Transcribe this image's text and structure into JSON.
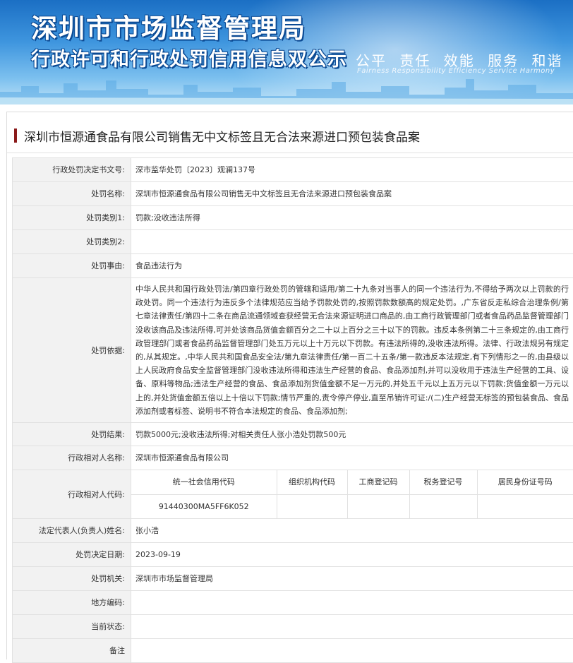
{
  "banner": {
    "title": "深圳市市场监督管理局",
    "subtitle": "行政许可和行政处罚信用信息双公示",
    "slogan": [
      "公平",
      "责任",
      "效能",
      "服务",
      "和谐"
    ],
    "slogan_en": "Fairness  Responsibility  Efficiency  Service  Harmony"
  },
  "case_title": "深圳市恒源通食品有限公司销售无中文标签且无合法来源进口预包装食品案",
  "rows": {
    "decision_no": {
      "label": "行政处罚决定书文号:",
      "value": "深市监华处罚〔2023〕观澜137号"
    },
    "name": {
      "label": "处罚名称:",
      "value": "深圳市恒源通食品有限公司销售无中文标签且无合法来源进口预包装食品案"
    },
    "category1": {
      "label": "处罚类别1:",
      "value": "罚款;没收违法所得"
    },
    "category2": {
      "label": "处罚类别2:",
      "value": ""
    },
    "reason": {
      "label": "处罚事由:",
      "value": "食品违法行为"
    },
    "basis": {
      "label": "处罚依据:",
      "value": "中华人民共和国行政处罚法/第四章行政处罚的管辖和适用/第二十九条对当事人的同一个违法行为,不得给予两次以上罚款的行政处罚。同一个违法行为违反多个法律规范应当给予罚款处罚的,按照罚款数额高的规定处罚。,广东省反走私综合治理条例/第七章法律责任/第四十二条在商品流通领域查获经营无合法来源证明进口商品的,由工商行政管理部门或者食品药品监督管理部门没收该商品及违法所得,可并处该商品货值金额百分之二十以上百分之三十以下的罚款。违反本条例第二十三条规定的,由工商行政管理部门或者食品药品监督管理部门处五万元以上十万元以下罚款。有违法所得的,没收违法所得。法律、行政法规另有规定的,从其规定。,中华人民共和国食品安全法/第九章法律责任/第一百二十五条/第一款违反本法规定,有下列情形之一的,由县级以上人民政府食品安全监督管理部门没收违法所得和违法生产经营的食品、食品添加剂,并可以没收用于违法生产经营的工具、设备、原料等物品;违法生产经营的食品、食品添加剂货值金额不足一万元的,并处五千元以上五万元以下罚款;货值金额一万元以上的,并处货值金额五倍以上十倍以下罚款;情节严重的,责令停产停业,直至吊销许可证:/(二)生产经营无标签的预包装食品、食品添加剂或者标签、说明书不符合本法规定的食品、食品添加剂;"
    },
    "result": {
      "label": "处罚结果:",
      "value": "罚款5000元;没收违法所得;对相关责任人张小浩处罚款500元"
    },
    "party_name": {
      "label": "行政相对人名称:",
      "value": "深圳市恒源通食品有限公司"
    },
    "party_code": {
      "label": "行政相对人代码:",
      "headers": [
        "统一社会信用代码",
        "组织机构代码",
        "工商登记码",
        "税务登记号",
        "居民身份证号码"
      ],
      "values": [
        "91440300MA5FF6K052",
        "",
        "",
        "",
        ""
      ]
    },
    "legal_rep": {
      "label": "法定代表人(负责人)姓名:",
      "value": "张小浩"
    },
    "date": {
      "label": "处罚决定日期:",
      "value": "2023-09-19"
    },
    "authority": {
      "label": "处罚机关:",
      "value": "深圳市市场监督管理局"
    },
    "area_code": {
      "label": "地方编码:",
      "value": ""
    },
    "status": {
      "label": "当前状态:",
      "value": ""
    },
    "remark": {
      "label": "备注",
      "value": ""
    }
  }
}
